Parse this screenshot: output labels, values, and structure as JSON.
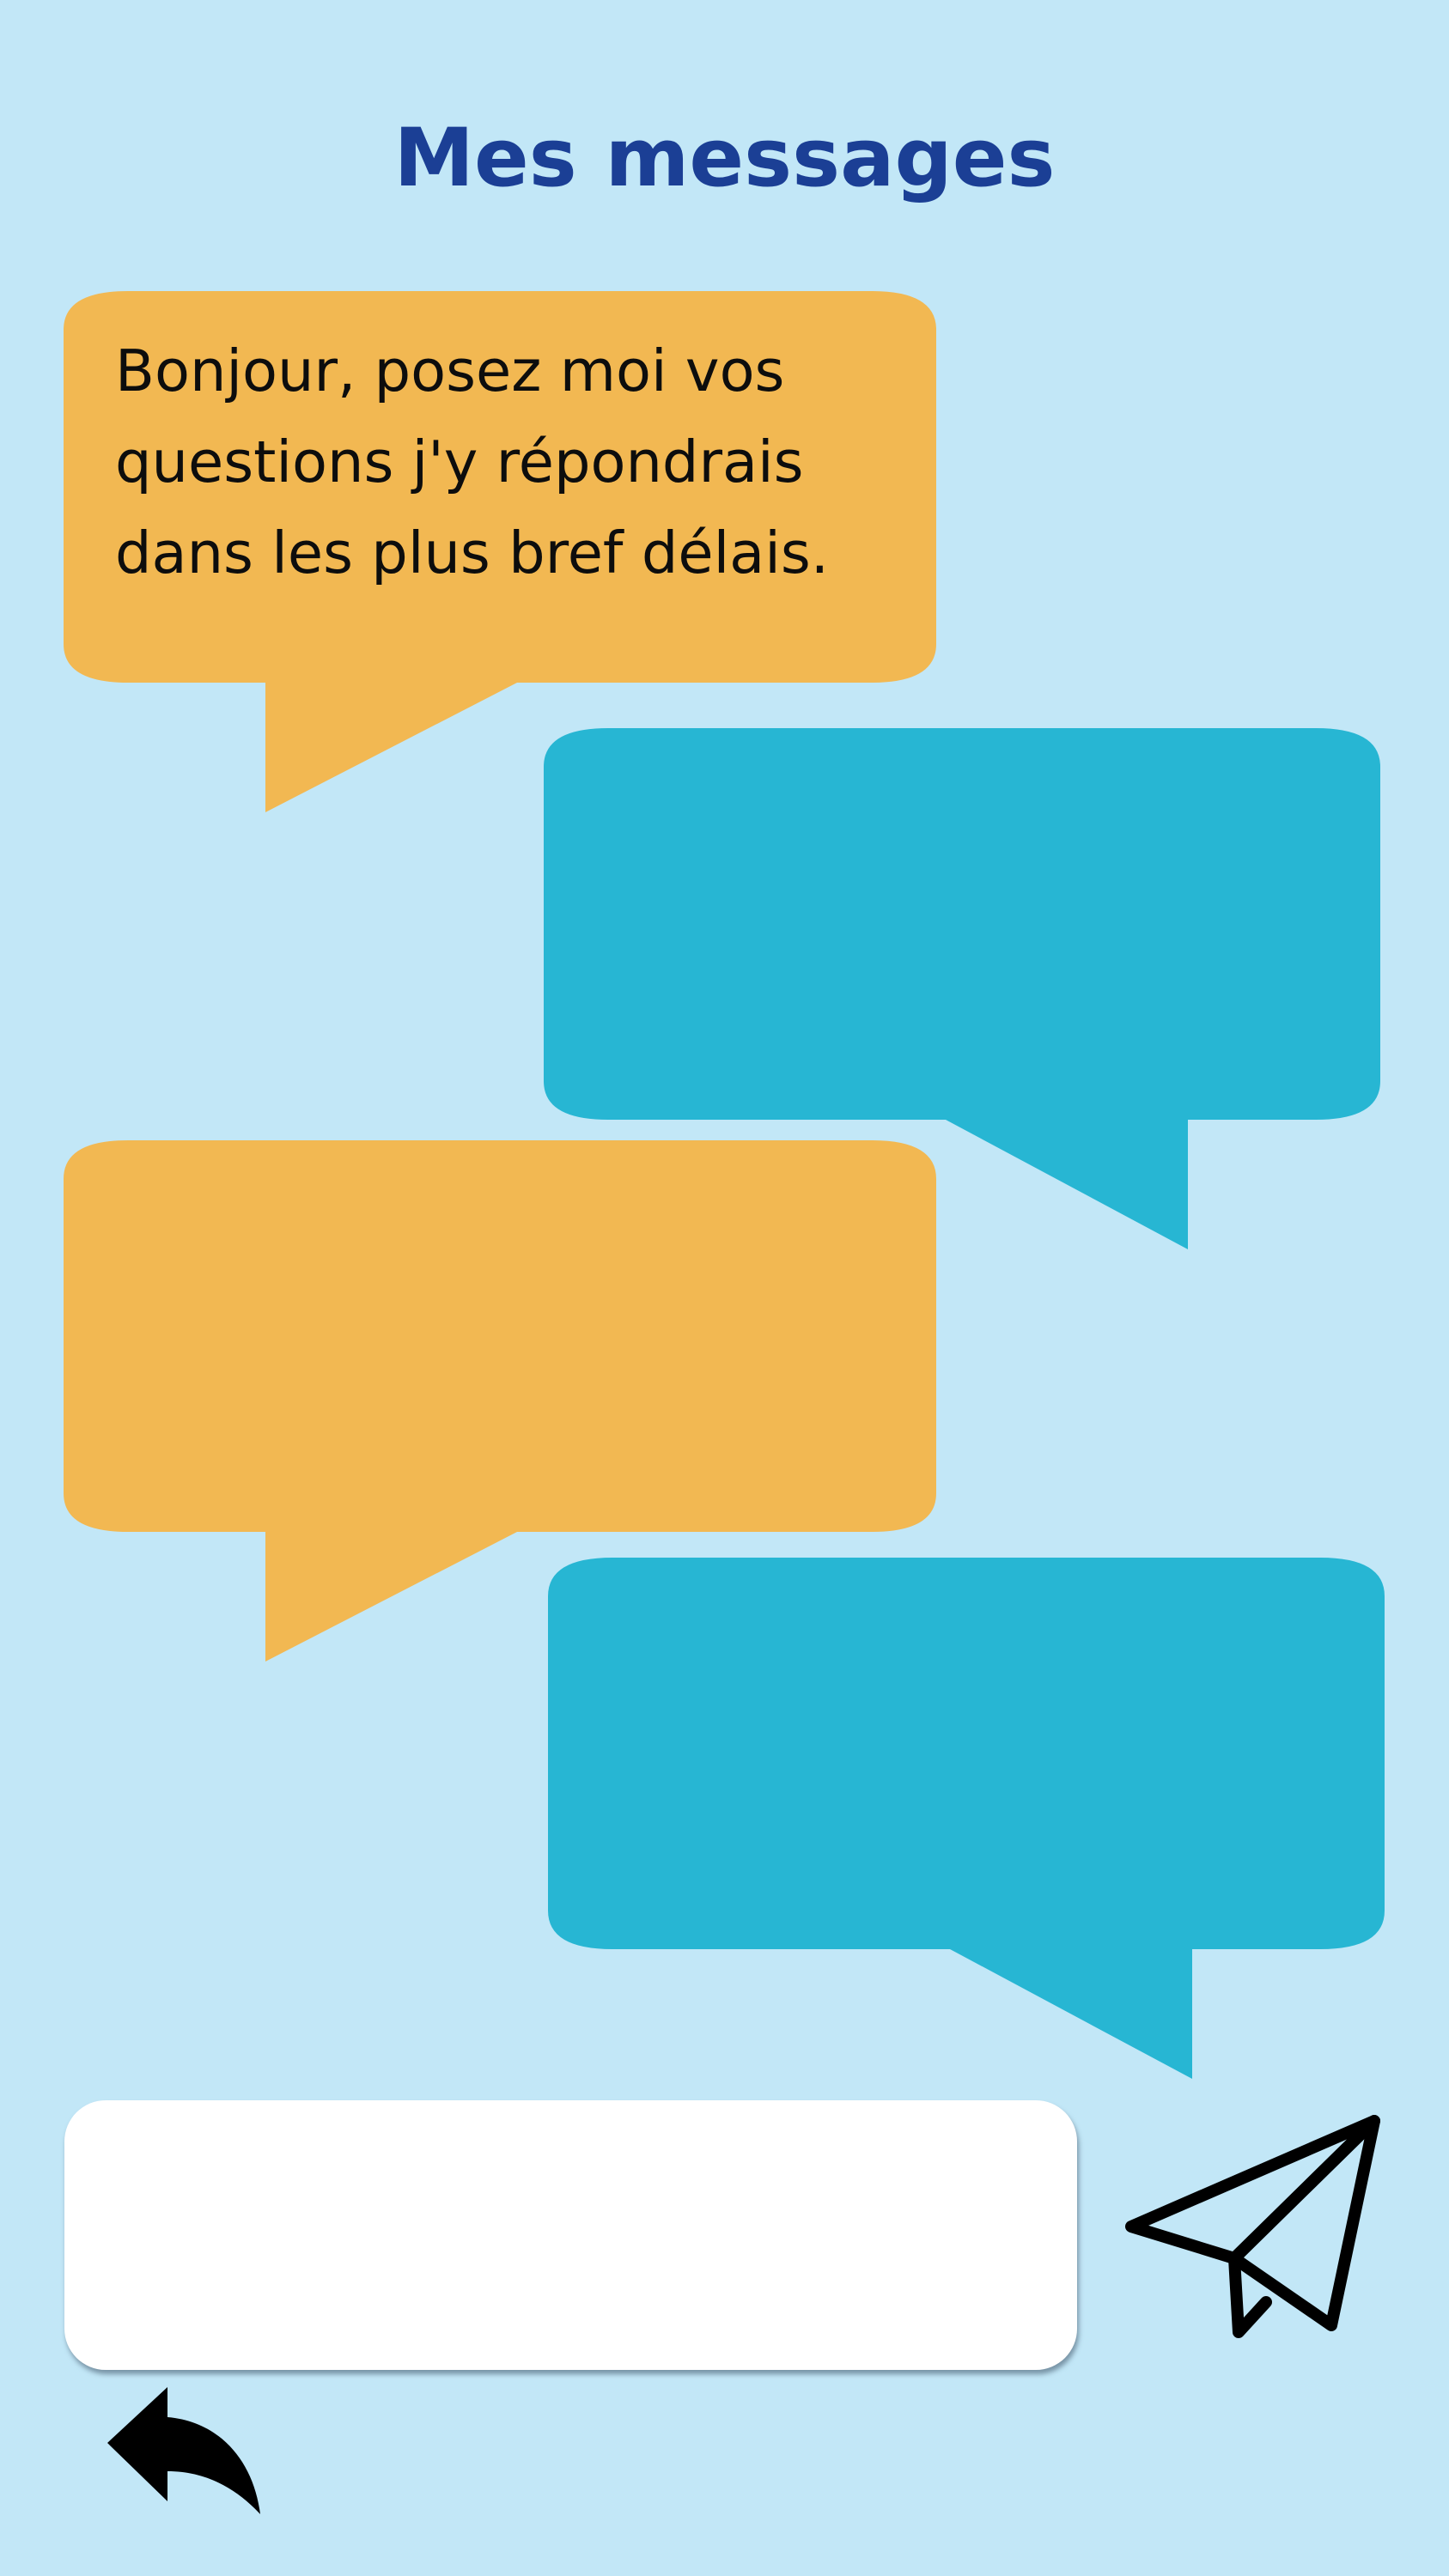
{
  "header": {
    "title": "Mes messages"
  },
  "conversation": {
    "messages": [
      {
        "sender": "assistant",
        "text": "Bonjour, posez moi vos\nquestions j'y répondrais\ndans les plus bref délais."
      },
      {
        "sender": "user",
        "text": ""
      },
      {
        "sender": "assistant",
        "text": ""
      },
      {
        "sender": "user",
        "text": ""
      }
    ]
  },
  "composer": {
    "value": "",
    "placeholder": "",
    "send_icon": "paper-plane-icon"
  },
  "navigation": {
    "back_icon": "back-arrow-icon"
  },
  "colors": {
    "background": "#c2e7f7",
    "title": "#1b3f95",
    "assistant_bubble": "#f2b852",
    "user_bubble": "#27b6d3",
    "input_background": "#ffffff"
  }
}
